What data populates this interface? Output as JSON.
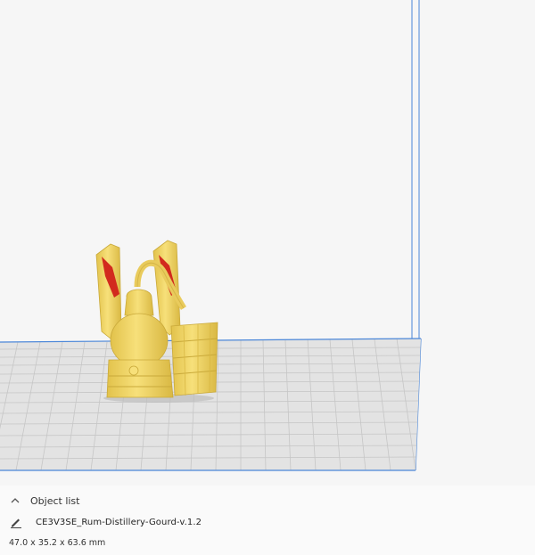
{
  "viewport": {
    "model_color": "#f0d35a",
    "model_outline": "#c9a93a",
    "overhang_color": "#d22a1e",
    "grid_color": "#c2c2c2",
    "build_volume_color": "#4a86d8",
    "background": "#f6f6f6"
  },
  "object_list": {
    "toggle_icon": "chevron-up-icon",
    "label": "Object list"
  },
  "selected_object": {
    "edit_icon": "pencil-icon",
    "name": "CE3V3SE_Rum-Distillery-Gourd-v.1.2",
    "dimensions": "47.0 x 35.2 x 63.6 mm"
  }
}
